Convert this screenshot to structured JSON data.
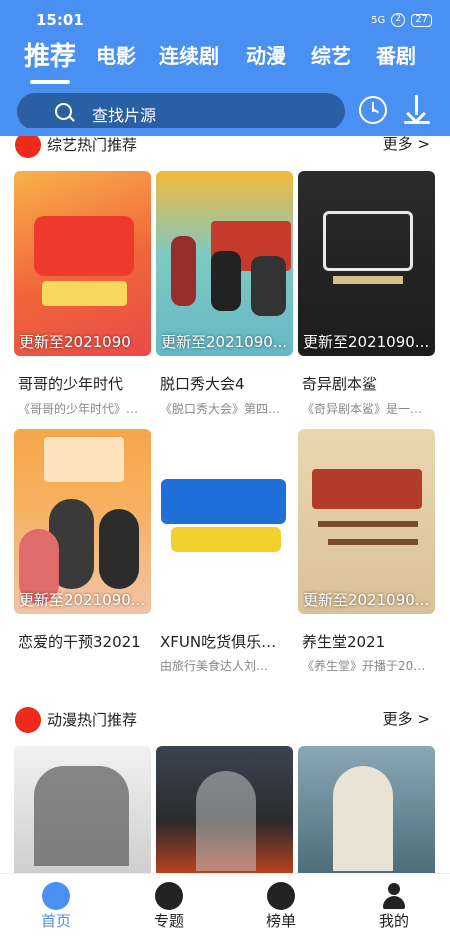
{
  "status": {
    "time": "15:01",
    "network": "5G",
    "battery": "27"
  },
  "tabs": [
    "推荐",
    "电影",
    "连续剧",
    "动漫",
    "综艺",
    "番剧"
  ],
  "search": {
    "placeholder": "找片源",
    "display": "查找片源"
  },
  "sections": {
    "variety": {
      "title": "综艺热门推荐",
      "more": "更多 >"
    },
    "anime": {
      "title": "动漫热门推荐",
      "more": "更多 >"
    }
  },
  "variety_cards": [
    {
      "cap": "更新至2021090",
      "title": "哥哥的少年时代",
      "desc": "《哥哥的少年时代》…"
    },
    {
      "cap": "更新至2021090...",
      "title": "脱口秀大会4",
      "desc": "《脱口秀大会》第四…"
    },
    {
      "cap": "更新至2021090...",
      "title": "奇异剧本鲨",
      "desc": "《奇异剧本鲨》是一…"
    },
    {
      "cap": "更新至2021090...",
      "title": "恋爱的干预32021",
      "desc": ""
    },
    {
      "cap": "",
      "title": "XFUN吃货俱乐…",
      "desc": "由旅行美食达人刘…"
    },
    {
      "cap": "更新至2021090...",
      "title": "养生堂2021",
      "desc": "《养生堂》开播于20…"
    }
  ],
  "nav": [
    {
      "label": "首页",
      "icon": "home-icon"
    },
    {
      "label": "专题",
      "icon": "topic-icon"
    },
    {
      "label": "榜单",
      "icon": "ranking-icon"
    },
    {
      "label": "我的",
      "icon": "profile-icon"
    }
  ],
  "colors": {
    "accent": "#4a8ff2",
    "section_dot": "#ee2a1b"
  }
}
